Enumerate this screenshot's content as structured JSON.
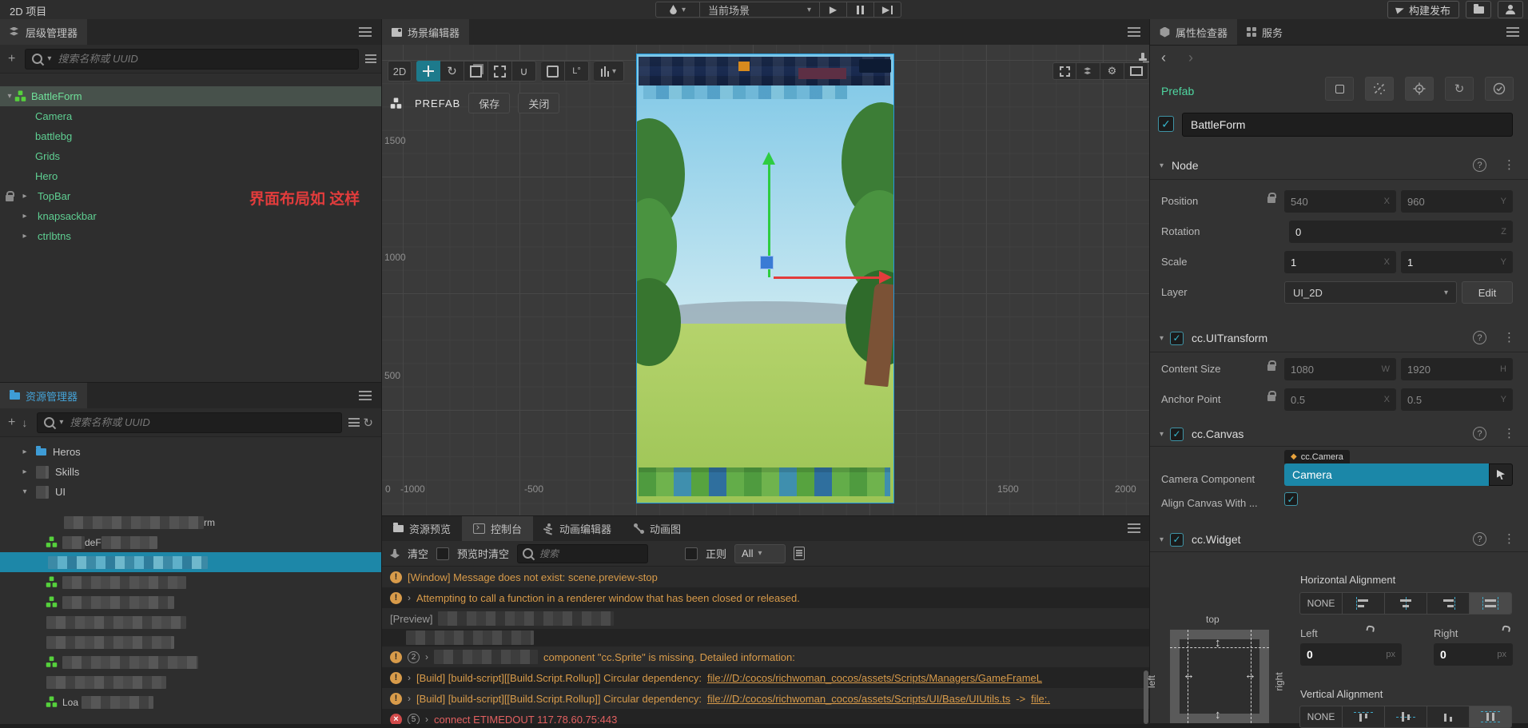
{
  "topbar": {
    "project_title": "2D 项目",
    "scene_select": "当前场景",
    "build": "构建发布"
  },
  "glyphs": {
    "chevron_down": "▾",
    "chevron_right": "▸",
    "nav_back": "‹",
    "nav_forward": "›",
    "expand": "›",
    "dots": "⋮",
    "help": "?",
    "plus": "+",
    "gear": "⚙",
    "rotate": "↻",
    "check": "✓",
    "play": "▶",
    "diamond": "◆",
    "warn": "!",
    "close": "×",
    "arrow_h": "↔",
    "arrow_v": "↕",
    "sort": "↓",
    "union": "∪",
    "pivot": "L°"
  },
  "colors": {
    "accent_teal": "#1d87a8",
    "prefab_green": "#57d48f",
    "warning_orange": "#d89b4a",
    "error_red": "#e26060",
    "annotation_red": "#e23c3c",
    "folder_blue": "#3e9cd6",
    "canvas_border_blue": "#1f9ae0"
  },
  "hierarchy": {
    "tab": "层级管理器",
    "search_placeholder": "搜索名称或 UUID",
    "annotation": "界面布局如 这样",
    "items": [
      {
        "label": "BattleForm"
      },
      {
        "label": "Camera"
      },
      {
        "label": "battlebg"
      },
      {
        "label": "Grids"
      },
      {
        "label": "Hero"
      },
      {
        "label": "TopBar"
      },
      {
        "label": "knapsackbar"
      },
      {
        "label": "ctrlbtns"
      }
    ]
  },
  "assets": {
    "tab": "资源管理器",
    "search_placeholder": "搜索名称或 UUID",
    "items": [
      {
        "label": "Heros"
      },
      {
        "label": "Skills"
      },
      {
        "label": "UI"
      }
    ],
    "fragments": {
      "row1": "rm",
      "row2": "deF",
      "last": "Loa"
    }
  },
  "scene": {
    "tab": "场景编辑器",
    "mode": "2D",
    "prefab": {
      "label": "PREFAB",
      "save": "保存",
      "close": "关闭"
    },
    "ruler_y": [
      "1500",
      "1000",
      "500"
    ],
    "ruler_x": [
      "0",
      "-1000",
      "-500",
      "1500",
      "2000"
    ]
  },
  "console": {
    "tabs": [
      "资源预览",
      "控制台",
      "动画编辑器",
      "动画图"
    ],
    "clear": "清空",
    "clear_on_preview": "预览时清空",
    "search_placeholder": "搜索",
    "regex": "正则",
    "filter_all": "All",
    "logs": [
      {
        "level": "warn",
        "text": "[Window] Message does not exist: scene.preview-stop"
      },
      {
        "level": "warn",
        "text": "Attempting to call a function in a renderer window that has been closed or released."
      },
      {
        "level": "info",
        "text": "[Preview]"
      },
      {
        "level": "warn",
        "badge": "2",
        "text": "component \"cc.Sprite\" is missing. Detailed information:"
      },
      {
        "level": "warn",
        "text": "[Build] [build-script][[Build.Script.Rollup]] Circular dependency: ",
        "link": "file:///D:/cocos/richwoman_cocos/assets/Scripts/Managers/GameFrameL"
      },
      {
        "level": "warn",
        "text": "[Build] [build-script][[Build.Script.Rollup]] Circular dependency: ",
        "link": "file:///D:/cocos/richwoman_cocos/assets/Scripts/UI/Base/UIUtils.ts",
        "mid": " -> ",
        "link2": "file:."
      },
      {
        "level": "error",
        "badge": "5",
        "text": "connect ETIMEDOUT 117.78.60.75:443"
      }
    ]
  },
  "inspector": {
    "tab_properties": "属性检查器",
    "tab_services": "服务",
    "prefab_label": "Prefab",
    "node": {
      "name": "BattleForm",
      "title": "Node",
      "position_label": "Position",
      "position_x": "540",
      "position_y": "960",
      "rotation_label": "Rotation",
      "rotation_z": "0",
      "scale_label": "Scale",
      "scale_x": "1",
      "scale_y": "1",
      "layer_label": "Layer",
      "layer_value": "UI_2D",
      "edit": "Edit",
      "axis_x": "X",
      "axis_y": "Y",
      "axis_z": "Z",
      "axis_w": "W",
      "axis_h": "H"
    },
    "uitransform": {
      "title": "cc.UITransform",
      "content_size_label": "Content Size",
      "width": "1080",
      "height": "1920",
      "anchor_label": "Anchor Point",
      "anchor_x": "0.5",
      "anchor_y": "0.5"
    },
    "canvas": {
      "title": "cc.Canvas",
      "camera_label": "Camera Component",
      "camera_tag": "cc.Camera",
      "camera_value": "Camera",
      "align_label": "Align Canvas With ..."
    },
    "widget": {
      "title": "cc.Widget",
      "h_label": "Horizontal Alignment",
      "v_label": "Vertical Alignment",
      "none": "NONE",
      "left_label": "Left",
      "right_label": "Right",
      "left_value": "0",
      "right_value": "0",
      "unit": "px",
      "top": "top",
      "left_side": "left",
      "right_side": "right"
    }
  }
}
